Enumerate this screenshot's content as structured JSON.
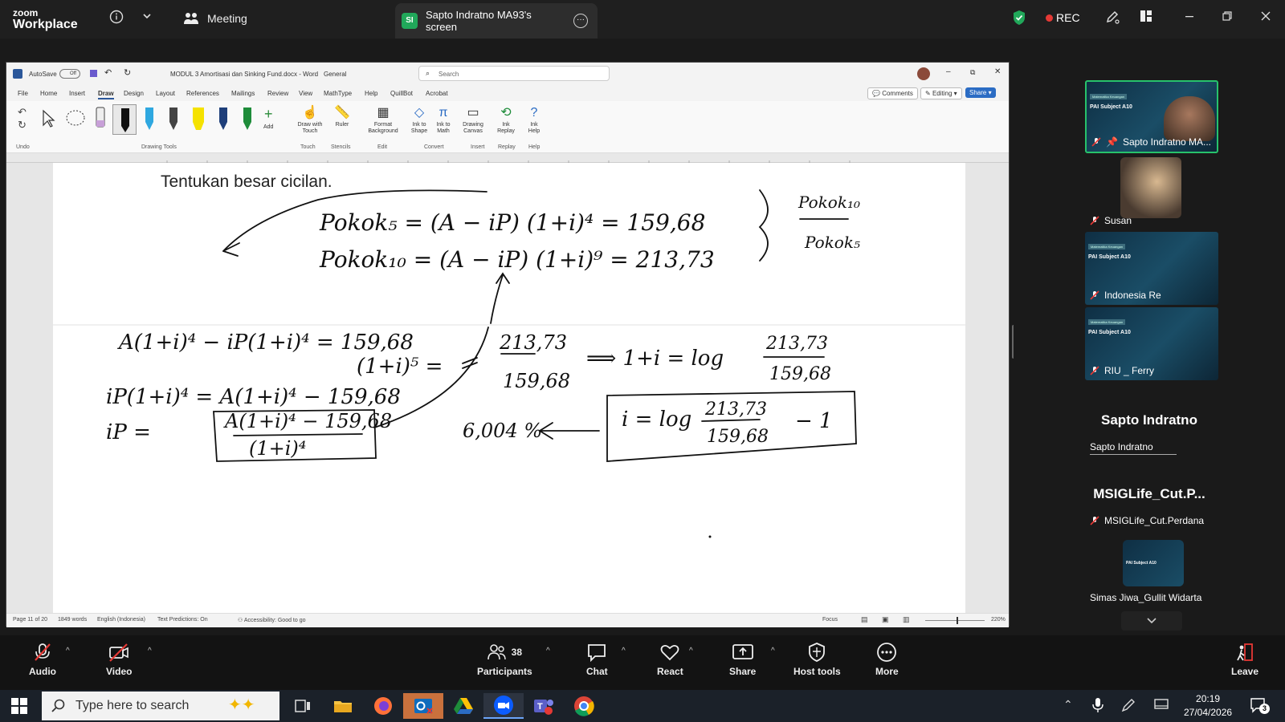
{
  "zoom": {
    "logo_line1": "zoom",
    "logo_line2": "Workplace",
    "meeting_label": "Meeting",
    "share_tab": {
      "badge": "SI",
      "label": "Sapto Indratno MA93's screen"
    },
    "rec_label": "REC",
    "accent_green": "#21a85a",
    "rec_color": "#e53935"
  },
  "word": {
    "autosave": "AutoSave",
    "autosave_state": "Off",
    "doc_title": "MODUL 3 Amortisasi dan Sinking Fund.docx  -  Word",
    "sensitivity": "General",
    "search_placeholder": "Search",
    "menu": [
      "File",
      "Home",
      "Insert",
      "Draw",
      "Design",
      "Layout",
      "References",
      "Mailings",
      "Review",
      "View",
      "MathType",
      "Help",
      "QuillBot",
      "Acrobat"
    ],
    "active_menu": "Draw",
    "comments_btn": "Comments",
    "editing_btn": "Editing",
    "share_btn": "Share",
    "ribbon": {
      "undo_group": "Undo",
      "drawing_tools_group": "Drawing Tools",
      "add_label": "Add",
      "draw_with_touch": "Draw with Touch",
      "ruler": "Ruler",
      "format_background": "Format Background",
      "ink_to_shape": "Ink to Shape",
      "ink_to_math": "Ink to Math",
      "drawing_canvas": "Drawing Canvas",
      "ink_replay": "Ink Replay",
      "ink_help": "Ink Help",
      "groups": [
        "Touch",
        "Stencils",
        "Edit",
        "Convert",
        "Insert",
        "Replay",
        "Help"
      ]
    },
    "doc_text": "Tentukan besar cicilan.",
    "handwriting": {
      "line1": "Pokok₅ = (A − iP) (1+i)⁴ = 159,68",
      "line2": "Pokok₁₀ = (A − iP) (1+i)⁹ = 213,73",
      "side_num": "Pokok₁₀",
      "side_den": "Pokok₅",
      "eq3": "A(1+i)⁴ − iP(1+i)⁴ = 159,68",
      "eq4": "iP(1+i)⁴ = A(1+i)⁴ − 159,68",
      "eq5_lhs": "iP =",
      "eq5_num": "A(1+i)⁴ − 159,68",
      "eq5_den": "(1+i)⁴",
      "mid_term": "(1+i)⁵ =",
      "frac_num": "213,73",
      "frac_den": "159,68",
      "implies": "⟹  1+i = log",
      "i_eq": "i = log",
      "minus_one": "− 1",
      "result": "6,004 %"
    },
    "status": {
      "page": "Page 11 of 20",
      "words": "1849 words",
      "language": "English (Indonesia)",
      "predictions": "Text Predictions: On",
      "accessibility": "Accessibility: Good to go",
      "focus": "Focus",
      "zoom": "220%"
    }
  },
  "participants": {
    "tiles": [
      {
        "name": "Sapto Indratno MA...",
        "kind": "video",
        "active": true
      },
      {
        "name": "Susan",
        "kind": "photo"
      },
      {
        "name": "Indonesia Re",
        "kind": "slide"
      },
      {
        "name": "RIU _ Ferry",
        "kind": "slide"
      }
    ],
    "slide_title": "PAI Subject A10",
    "slide_sub": "Matematika Keuangan",
    "sections": [
      {
        "header": "Sapto Indratno",
        "item": "Sapto Indratno"
      },
      {
        "header": "MSIGLife_Cut.P...",
        "item": "MSIGLife_Cut.Perdana"
      }
    ],
    "last_tile_name": "Simas Jiwa_Gullit Widarta",
    "highlight_border": "#27c26b"
  },
  "toolbar": {
    "audio": "Audio",
    "video": "Video",
    "participants": "Participants",
    "participant_count": "38",
    "chat": "Chat",
    "react": "React",
    "share": "Share",
    "host_tools": "Host tools",
    "more": "More",
    "leave": "Leave"
  },
  "taskbar": {
    "search_placeholder": "Type here to search",
    "time": "20:19",
    "date": "27/04/2026",
    "notif_count": "3"
  }
}
